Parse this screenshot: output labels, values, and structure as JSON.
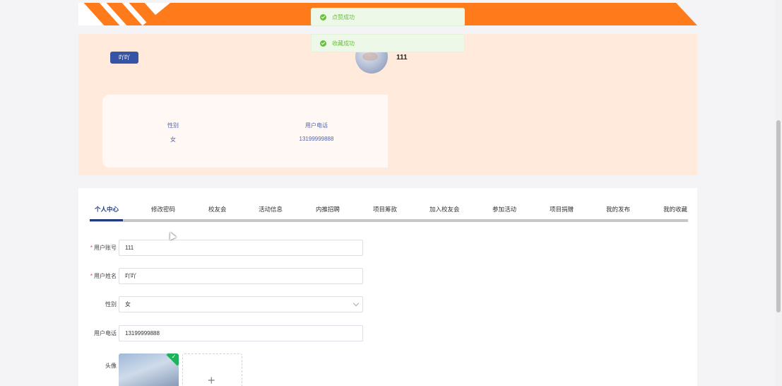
{
  "toasts": {
    "like_success": "点赞成功",
    "collect_success": "收藏成功"
  },
  "profile": {
    "name_tag": "吖吖",
    "account": "111",
    "info": {
      "gender_label": "性别",
      "gender_value": "女",
      "phone_label": "用户电话",
      "phone_value": "13199999888"
    }
  },
  "tabs": [
    {
      "label": "个人中心",
      "active": true
    },
    {
      "label": "修改密码"
    },
    {
      "label": "校友会"
    },
    {
      "label": "活动信息"
    },
    {
      "label": "内推招聘"
    },
    {
      "label": "项目筹款"
    },
    {
      "label": "加入校友会"
    },
    {
      "label": "参加活动"
    },
    {
      "label": "项目捐赠"
    },
    {
      "label": "我的发布"
    },
    {
      "label": "我的收藏"
    }
  ],
  "form": {
    "account": {
      "label": "用户账号",
      "value": "111",
      "required": true
    },
    "name": {
      "label": "用户姓名",
      "value": "吖吖",
      "required": true
    },
    "gender": {
      "label": "性别",
      "value": "女"
    },
    "phone": {
      "label": "用户电话",
      "value": "13199999888"
    },
    "avatar": {
      "label": "头像",
      "add_symbol": "+"
    }
  },
  "colors": {
    "banner": "#ff7a1a",
    "profile_bg": "#ffeadb",
    "accent": "#233a7a",
    "success": "#67c23a"
  }
}
